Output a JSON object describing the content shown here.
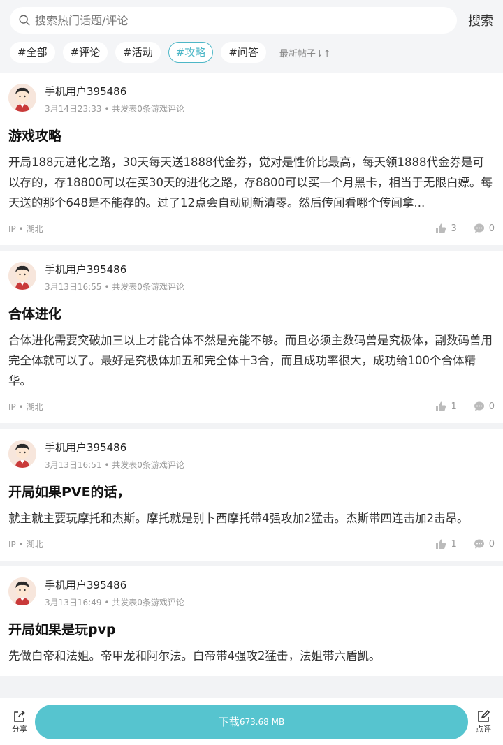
{
  "search": {
    "placeholder": "搜索热门话题/评论",
    "button": "搜索"
  },
  "filters": {
    "chips": [
      "#全部",
      "#评论",
      "#活动",
      "#攻略",
      "#问答"
    ],
    "active_index": 3,
    "sort_label": "最新帖子⇂↑"
  },
  "posts": [
    {
      "author": "手机用户395486",
      "time": "3月14日23:33",
      "meta_suffix": "• 共发表0条游戏评论",
      "title": "游戏攻略",
      "body": "开局188元进化之路，30天每天送1888代金券，觉对是性价比最高，每天领1888代金券是可以存的，存18800可以在买30天的进化之路，存8800可以买一个月黑卡，相当于无限白嫖。每天送的那个648是不能存的。过了12点会自动刷新清零。然后传闻看哪个传闻拿...",
      "ip": "IP • 湖北",
      "likes": "3",
      "comments": "0"
    },
    {
      "author": "手机用户395486",
      "time": "3月13日16:55",
      "meta_suffix": "• 共发表0条游戏评论",
      "title": "合体进化",
      "body": "合体进化需要突破加三以上才能合体不然是充能不够。而且必须主数码兽是究极体，副数码兽用完全体就可以了。最好是究极体加五和完全体十3合，而且成功率很大，成功给100个合体精华。",
      "ip": "IP • 湖北",
      "likes": "1",
      "comments": "0"
    },
    {
      "author": "手机用户395486",
      "time": "3月13日16:51",
      "meta_suffix": "• 共发表0条游戏评论",
      "title": "开局如果PVE的话，",
      "body": "就主就主要玩摩托和杰斯。摩托就是别卜西摩托带4强攻加2猛击。杰斯带四连击加2击昂。",
      "ip": "IP • 湖北",
      "likes": "1",
      "comments": "0"
    },
    {
      "author": "手机用户395486",
      "time": "3月13日16:49",
      "meta_suffix": "• 共发表0条游戏评论",
      "title": "开局如果是玩pvp",
      "body": "先做白帝和法姐。帝甲龙和阿尔法。白帝带4强攻2猛击，法姐带六盾凯。",
      "ip": "",
      "likes": "",
      "comments": ""
    }
  ],
  "bottom": {
    "share": "分享",
    "download_label": "下载",
    "download_size": "673.68 MB",
    "review": "点评"
  },
  "colors": {
    "accent": "#4db7c7",
    "download_bg": "#56c4cf"
  }
}
